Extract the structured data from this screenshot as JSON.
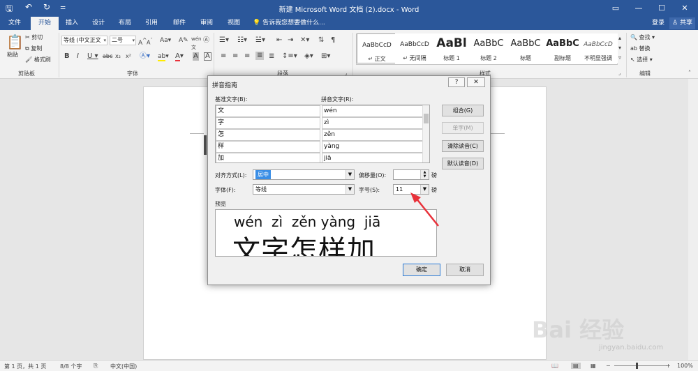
{
  "app": {
    "title": "新建 Microsoft Word 文档 (2).docx - Word",
    "tabs": [
      "文件",
      "开始",
      "插入",
      "设计",
      "布局",
      "引用",
      "邮件",
      "审阅",
      "视图"
    ],
    "active_tab": "开始",
    "tell_me": "告诉我您想要做什么...",
    "login": "登录",
    "share": "共享"
  },
  "ribbon": {
    "clipboard": {
      "paste": "粘贴",
      "cut": "剪切",
      "copy": "复制",
      "format_painter": "格式刷",
      "label": "剪贴板"
    },
    "font": {
      "font_name": "等线 (中文正文",
      "font_size": "二号",
      "label": "字体"
    },
    "paragraph": {
      "label": "段落"
    },
    "styles": {
      "label": "样式",
      "items": [
        {
          "sample": "AaBbCcD",
          "name": "正文"
        },
        {
          "sample": "AaBbCcD",
          "name": "无间隔"
        },
        {
          "sample": "AaBl",
          "name": "标题 1"
        },
        {
          "sample": "AaBbC",
          "name": "标题 2"
        },
        {
          "sample": "AaBbC",
          "name": "标题"
        },
        {
          "sample": "AaBbC",
          "name": "副标题"
        },
        {
          "sample": "AaBbCcD",
          "name": "不明显强调"
        }
      ]
    },
    "editing": {
      "find": "查找",
      "replace": "替换",
      "select": "选择",
      "label": "编辑"
    }
  },
  "dialog": {
    "title": "拼音指南",
    "help": "?",
    "base_label": "基准文字(B):",
    "ruby_label": "拼音文字(R):",
    "rows": [
      {
        "base": "文",
        "ruby": "wén"
      },
      {
        "base": "字",
        "ruby": "zì"
      },
      {
        "base": "怎",
        "ruby": "zěn"
      },
      {
        "base": "样",
        "ruby": "yàng"
      },
      {
        "base": "加",
        "ruby": "jiā"
      }
    ],
    "buttons": {
      "group": "组合(G)",
      "single": "单字(M)",
      "clear": "清除读音(C)",
      "default": "默认读音(D)",
      "ok": "确定",
      "cancel": "取消"
    },
    "alignment_label": "对齐方式(L):",
    "alignment_value": "居中",
    "offset_label": "偏移量(O):",
    "offset_value": "",
    "offset_unit": "磅",
    "font_label": "字体(F):",
    "font_value": "等线",
    "size_label": "字号(S):",
    "size_value": "11",
    "size_unit": "磅",
    "preview_label": "预览",
    "preview_pinyin": "wén  zì  zěn yàng  jiā",
    "preview_base": "文字怎样加"
  },
  "statusbar": {
    "page": "第 1 页，共 1 页",
    "words": "8/8 个字",
    "language": "中文(中国)",
    "zoom": "100%"
  },
  "watermark": {
    "logo": "Bai 经验",
    "url": "jingyan.baidu.com"
  },
  "colors": {
    "title_bar": "#2b579a",
    "accent_arrow": "#e8313a",
    "selection": "#3a8ee6"
  }
}
